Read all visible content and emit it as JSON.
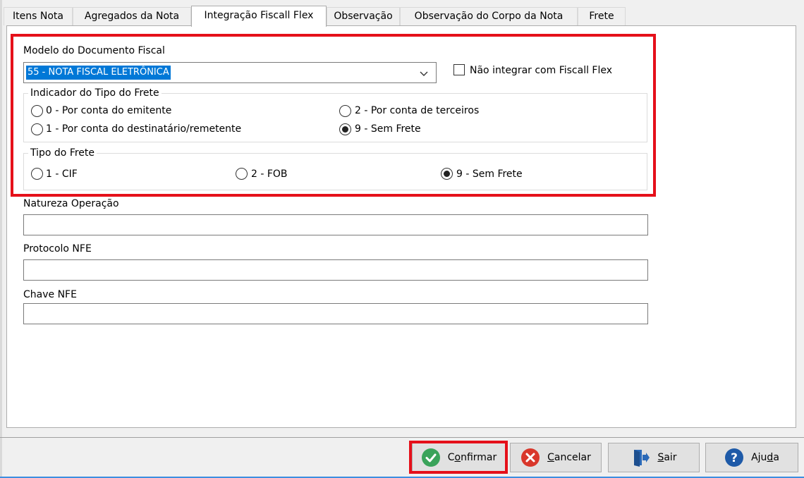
{
  "tabs": [
    {
      "label": "Itens Nota"
    },
    {
      "label": "Agregados da Nota"
    },
    {
      "label": "Integração Fiscall Flex"
    },
    {
      "label": "Observação"
    },
    {
      "label": "Observação do Corpo da Nota"
    },
    {
      "label": "Frete"
    }
  ],
  "active_tab": "Integração Fiscall Flex",
  "modelo": {
    "label": "Modelo do Documento Fiscal",
    "value": "55 - NOTA FISCAL ELETRÔNICA",
    "checkbox_label": "Não integrar com Fiscall Flex",
    "checkbox_checked": false
  },
  "indicador_frete": {
    "title": "Indicador do Tipo do Frete",
    "options": [
      {
        "label": "0 - Por conta do emitente",
        "checked": false
      },
      {
        "label": "2 - Por conta de terceiros",
        "checked": false
      },
      {
        "label": "1 - Por conta do destinatário/remetente",
        "checked": false
      },
      {
        "label": "9 - Sem Frete",
        "checked": true
      }
    ]
  },
  "tipo_frete": {
    "title": "Tipo do Frete",
    "options": [
      {
        "label": "1 - CIF",
        "checked": false
      },
      {
        "label": "2 - FOB",
        "checked": false
      },
      {
        "label": "9 - Sem Frete",
        "checked": true
      }
    ]
  },
  "fields": {
    "natureza_label": "Natureza Operação",
    "natureza_value": "",
    "protocolo_label": "Protocolo NFE",
    "protocolo_value": "",
    "chave_label": "Chave NFE",
    "chave_value": ""
  },
  "buttons": {
    "confirmar": {
      "pre": "C",
      "acc": "o",
      "post": "nfirmar"
    },
    "cancelar": {
      "pre": "",
      "acc": "C",
      "post": "ancelar"
    },
    "sair": {
      "pre": "",
      "acc": "S",
      "post": "air"
    },
    "ajuda": {
      "pre": "Aju",
      "acc": "d",
      "post": "a"
    }
  },
  "colors": {
    "highlight": "#e5101a",
    "selection": "#0078d7",
    "confirm_icon": "#3aa35a",
    "cancel_icon": "#d9372b",
    "help_icon": "#1e5aa8",
    "exit_icon": "#2a69b8"
  },
  "icons": [
    "check-circle-icon",
    "x-circle-icon",
    "exit-door-icon",
    "question-circle-icon",
    "chevron-down-icon"
  ]
}
